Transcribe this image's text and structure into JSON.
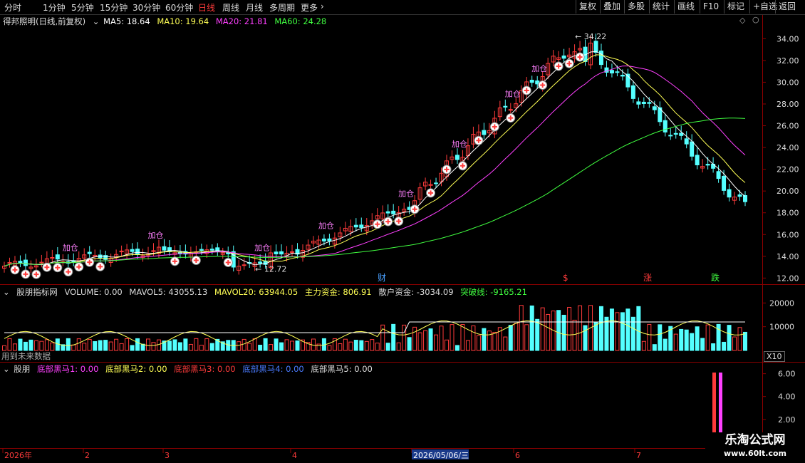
{
  "toolbar": {
    "timeframes": [
      "分时",
      "1分钟",
      "5分钟",
      "15分钟",
      "30分钟",
      "60分钟",
      "日线",
      "周线",
      "月线",
      "多周期",
      "更多"
    ],
    "active_timeframe": "日线",
    "buttons": [
      "复权",
      "叠加",
      "多股",
      "统计",
      "画线",
      "F10",
      "标记",
      "+自选",
      "返回"
    ]
  },
  "main_panel": {
    "stock_name": "得邦照明(日线,前复权)",
    "ma5": "MA5: 18.64",
    "ma10": "MA10: 19.64",
    "ma20": "MA20: 21.81",
    "ma60": "MA60: 24.28",
    "price_ticks": [
      "34.00",
      "32.00",
      "30.00",
      "28.00",
      "26.00",
      "24.00",
      "22.00",
      "20.00",
      "18.00",
      "16.00",
      "14.00",
      "12.00"
    ],
    "high_label": "34.22",
    "low_label": "12.72",
    "buy_label": "加仓",
    "signal_labels": [
      "财",
      "$",
      "涨",
      "跌"
    ]
  },
  "indicator_panel": {
    "name": "股朋指标网",
    "volume": "VOLUME: 0.00",
    "mavol5": "MAVOL5: 43055.13",
    "mavol20": "MAVOL20: 63944.05",
    "main_fund": "主力资金: 806.91",
    "retail_fund": "散户资金: -3034.09",
    "breakout": "突破线: -9165.21",
    "ticks": [
      "20000",
      "10000"
    ],
    "multiplier": "X10",
    "future_note": "用到未来数据"
  },
  "bottom_panel": {
    "name": "股朋",
    "h1": "底部黑马1: 0.00",
    "h2": "底部黑马2: 0.00",
    "h3": "底部黑马3: 0.00",
    "h4": "底部黑马4: 0.00",
    "h5": "底部黑马5: 0.00",
    "ticks": [
      "6.00",
      "4.00",
      "2.00"
    ]
  },
  "time_axis": {
    "labels": [
      "2026年",
      "2",
      "3",
      "4",
      "2026/05/06/三",
      "6",
      "7"
    ]
  },
  "watermark": {
    "line1": "乐淘公式网",
    "line2": "www.60lt.com"
  },
  "colors": {
    "up": "#ff3b3b",
    "down": "#54ffff",
    "ma5": "#ffffff",
    "ma10": "#ffff55",
    "ma20": "#ff40ff",
    "ma60": "#40ff40",
    "title_blue": "#4aa0ff"
  },
  "chart_data": {
    "type": "candlestick",
    "ma_values": {
      "MA5": 18.64,
      "MA10": 19.64,
      "MA20": 21.81,
      "MA60": 24.28
    },
    "price_high": 34.22,
    "price_low": 12.72,
    "ylim": [
      11.5,
      35.2
    ],
    "x_labels": [
      "2026年",
      "2",
      "3",
      "4",
      "2026/05/06/三",
      "6",
      "7"
    ]
  }
}
